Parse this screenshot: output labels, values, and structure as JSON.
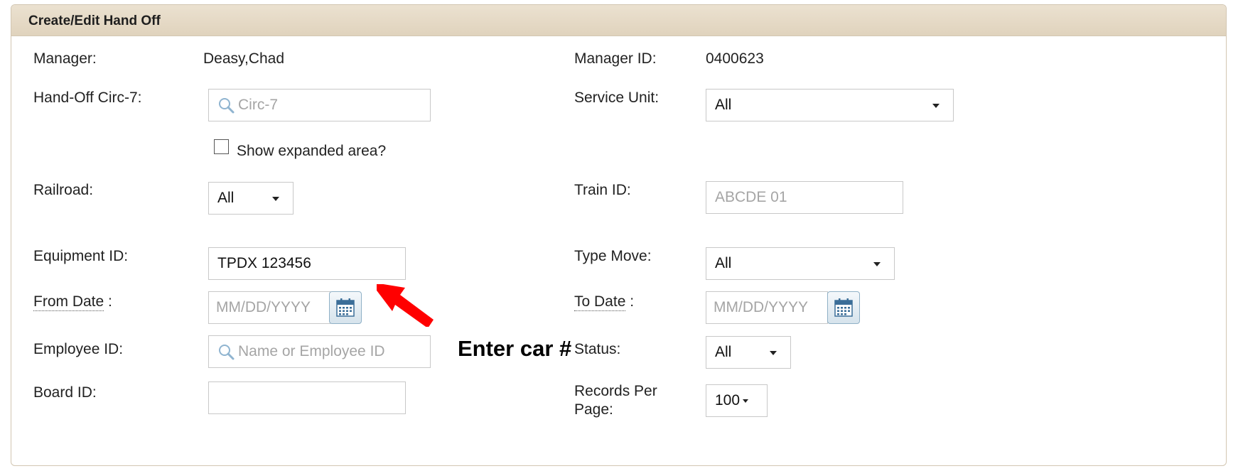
{
  "panel": {
    "title": "Create/Edit Hand Off"
  },
  "form": {
    "manager": {
      "label": "Manager:",
      "value": "Deasy,Chad"
    },
    "manager_id": {
      "label": "Manager ID:",
      "value": "0400623"
    },
    "hand_off_circ7": {
      "label": "Hand-Off Circ-7:",
      "placeholder": "Circ-7",
      "icon": "search-icon"
    },
    "service_unit": {
      "label": "Service Unit:",
      "value": "All"
    },
    "show_expanded": {
      "label": "Show expanded area?",
      "checked": false
    },
    "railroad": {
      "label": "Railroad:",
      "value": "All"
    },
    "train_id": {
      "label": "Train ID:",
      "value": "ABCDE 01"
    },
    "equipment_id": {
      "label": "Equipment ID:",
      "value": "TPDX 123456"
    },
    "type_move": {
      "label": "Type Move:",
      "value": "All"
    },
    "from_date": {
      "label": "From Date",
      "suffix": ":",
      "placeholder": "MM/DD/YYYY",
      "icon": "calendar-icon"
    },
    "to_date": {
      "label": "To Date",
      "suffix": ":",
      "placeholder": "MM/DD/YYYY",
      "icon": "calendar-icon"
    },
    "employee_id": {
      "label": "Employee ID:",
      "placeholder": "Name or Employee ID",
      "icon": "search-icon"
    },
    "status": {
      "label": "Status:",
      "value": "All"
    },
    "board_id": {
      "label": "Board ID:",
      "value": ""
    },
    "records_per_page": {
      "label": "Records Per Page:",
      "value": "100"
    }
  },
  "annotation": {
    "text": "Enter car #",
    "color": "#ff0000"
  },
  "colors": {
    "header_bg": "#e4d8c4",
    "panel_border": "#d2c6b2",
    "placeholder": "#a5a5a5",
    "calendar_blue": "#3b6e98"
  }
}
